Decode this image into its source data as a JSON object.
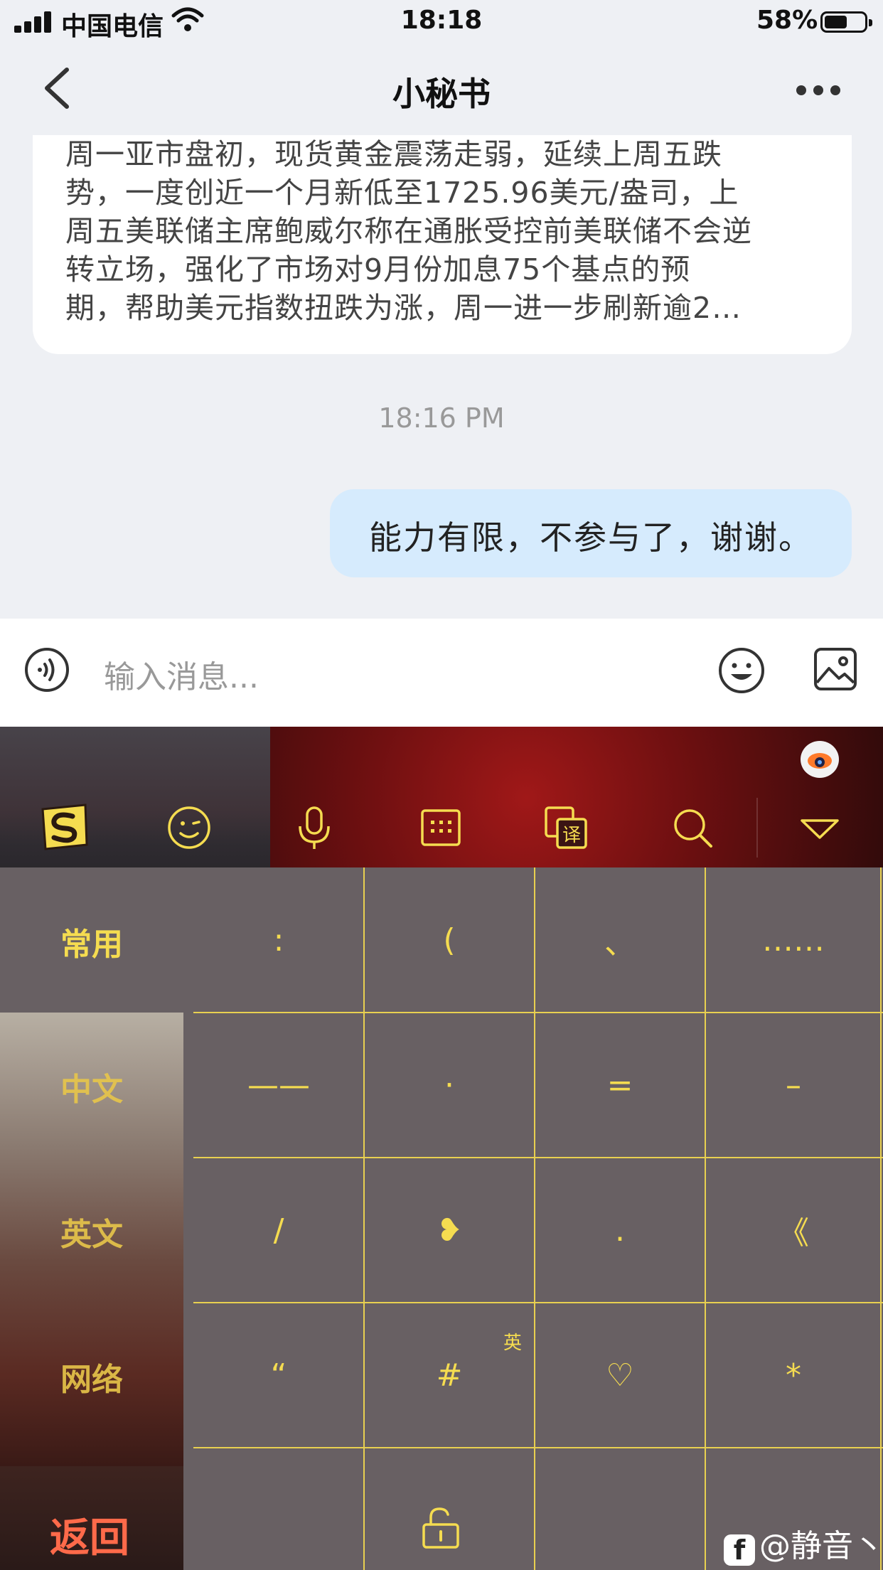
{
  "status_bar": {
    "carrier": "中国电信",
    "time": "18:18",
    "battery_pct": "58%",
    "battery_level": 0.58,
    "icons": [
      "signal-icon",
      "wifi-icon",
      "battery-icon"
    ]
  },
  "nav": {
    "title": "小秘书",
    "back_icon": "chevron-left-icon",
    "more_icon": "ellipsis-icon"
  },
  "chat": {
    "incoming_text": "周一亚市盘初，现货黄金震荡走弱，延续上周五跌\n势，一度创近一个月新低至1725.96美元/盎司，上\n周五美联储主席鲍威尔称在通胀受控前美联储不会逆\n转立场，强化了市场对9月份加息75个基点的预\n期，帮助美元指数扭跌为涨，周一进一步刷新逾2…",
    "timestamp": "18:16 PM",
    "outgoing_text": "能力有限，不参与了，谢谢。"
  },
  "input_bar": {
    "placeholder": "输入消息...",
    "icons": [
      "voice-icon",
      "emoji-icon",
      "image-icon"
    ]
  },
  "keyboard": {
    "toolbar_icons": [
      "sogou-logo-icon",
      "emoji-icon",
      "microphone-icon",
      "keyboard-icon",
      "translate-icon",
      "search-icon",
      "collapse-keyboard-icon"
    ],
    "translate_char": "译",
    "categories": [
      "常用",
      "中文",
      "英文",
      "网络"
    ],
    "row0": [
      ":",
      "(",
      "、",
      "……"
    ],
    "rows": [
      [
        "——",
        "·",
        "=",
        "–"
      ],
      [
        "/",
        "❥",
        ".",
        "《"
      ],
      [
        "“",
        "#",
        "♡",
        "*"
      ]
    ],
    "hash_superscript": "英",
    "return_label": "返回",
    "lock_icon": "unlock-icon",
    "watermark": "@静音丶",
    "watermark_logo": "f"
  },
  "colors": {
    "accent_yellow": "#f5dc50",
    "return_red": "#ff6a4a",
    "bubble_out": "#d6ebfd",
    "keyboard_panel": "#686063"
  }
}
